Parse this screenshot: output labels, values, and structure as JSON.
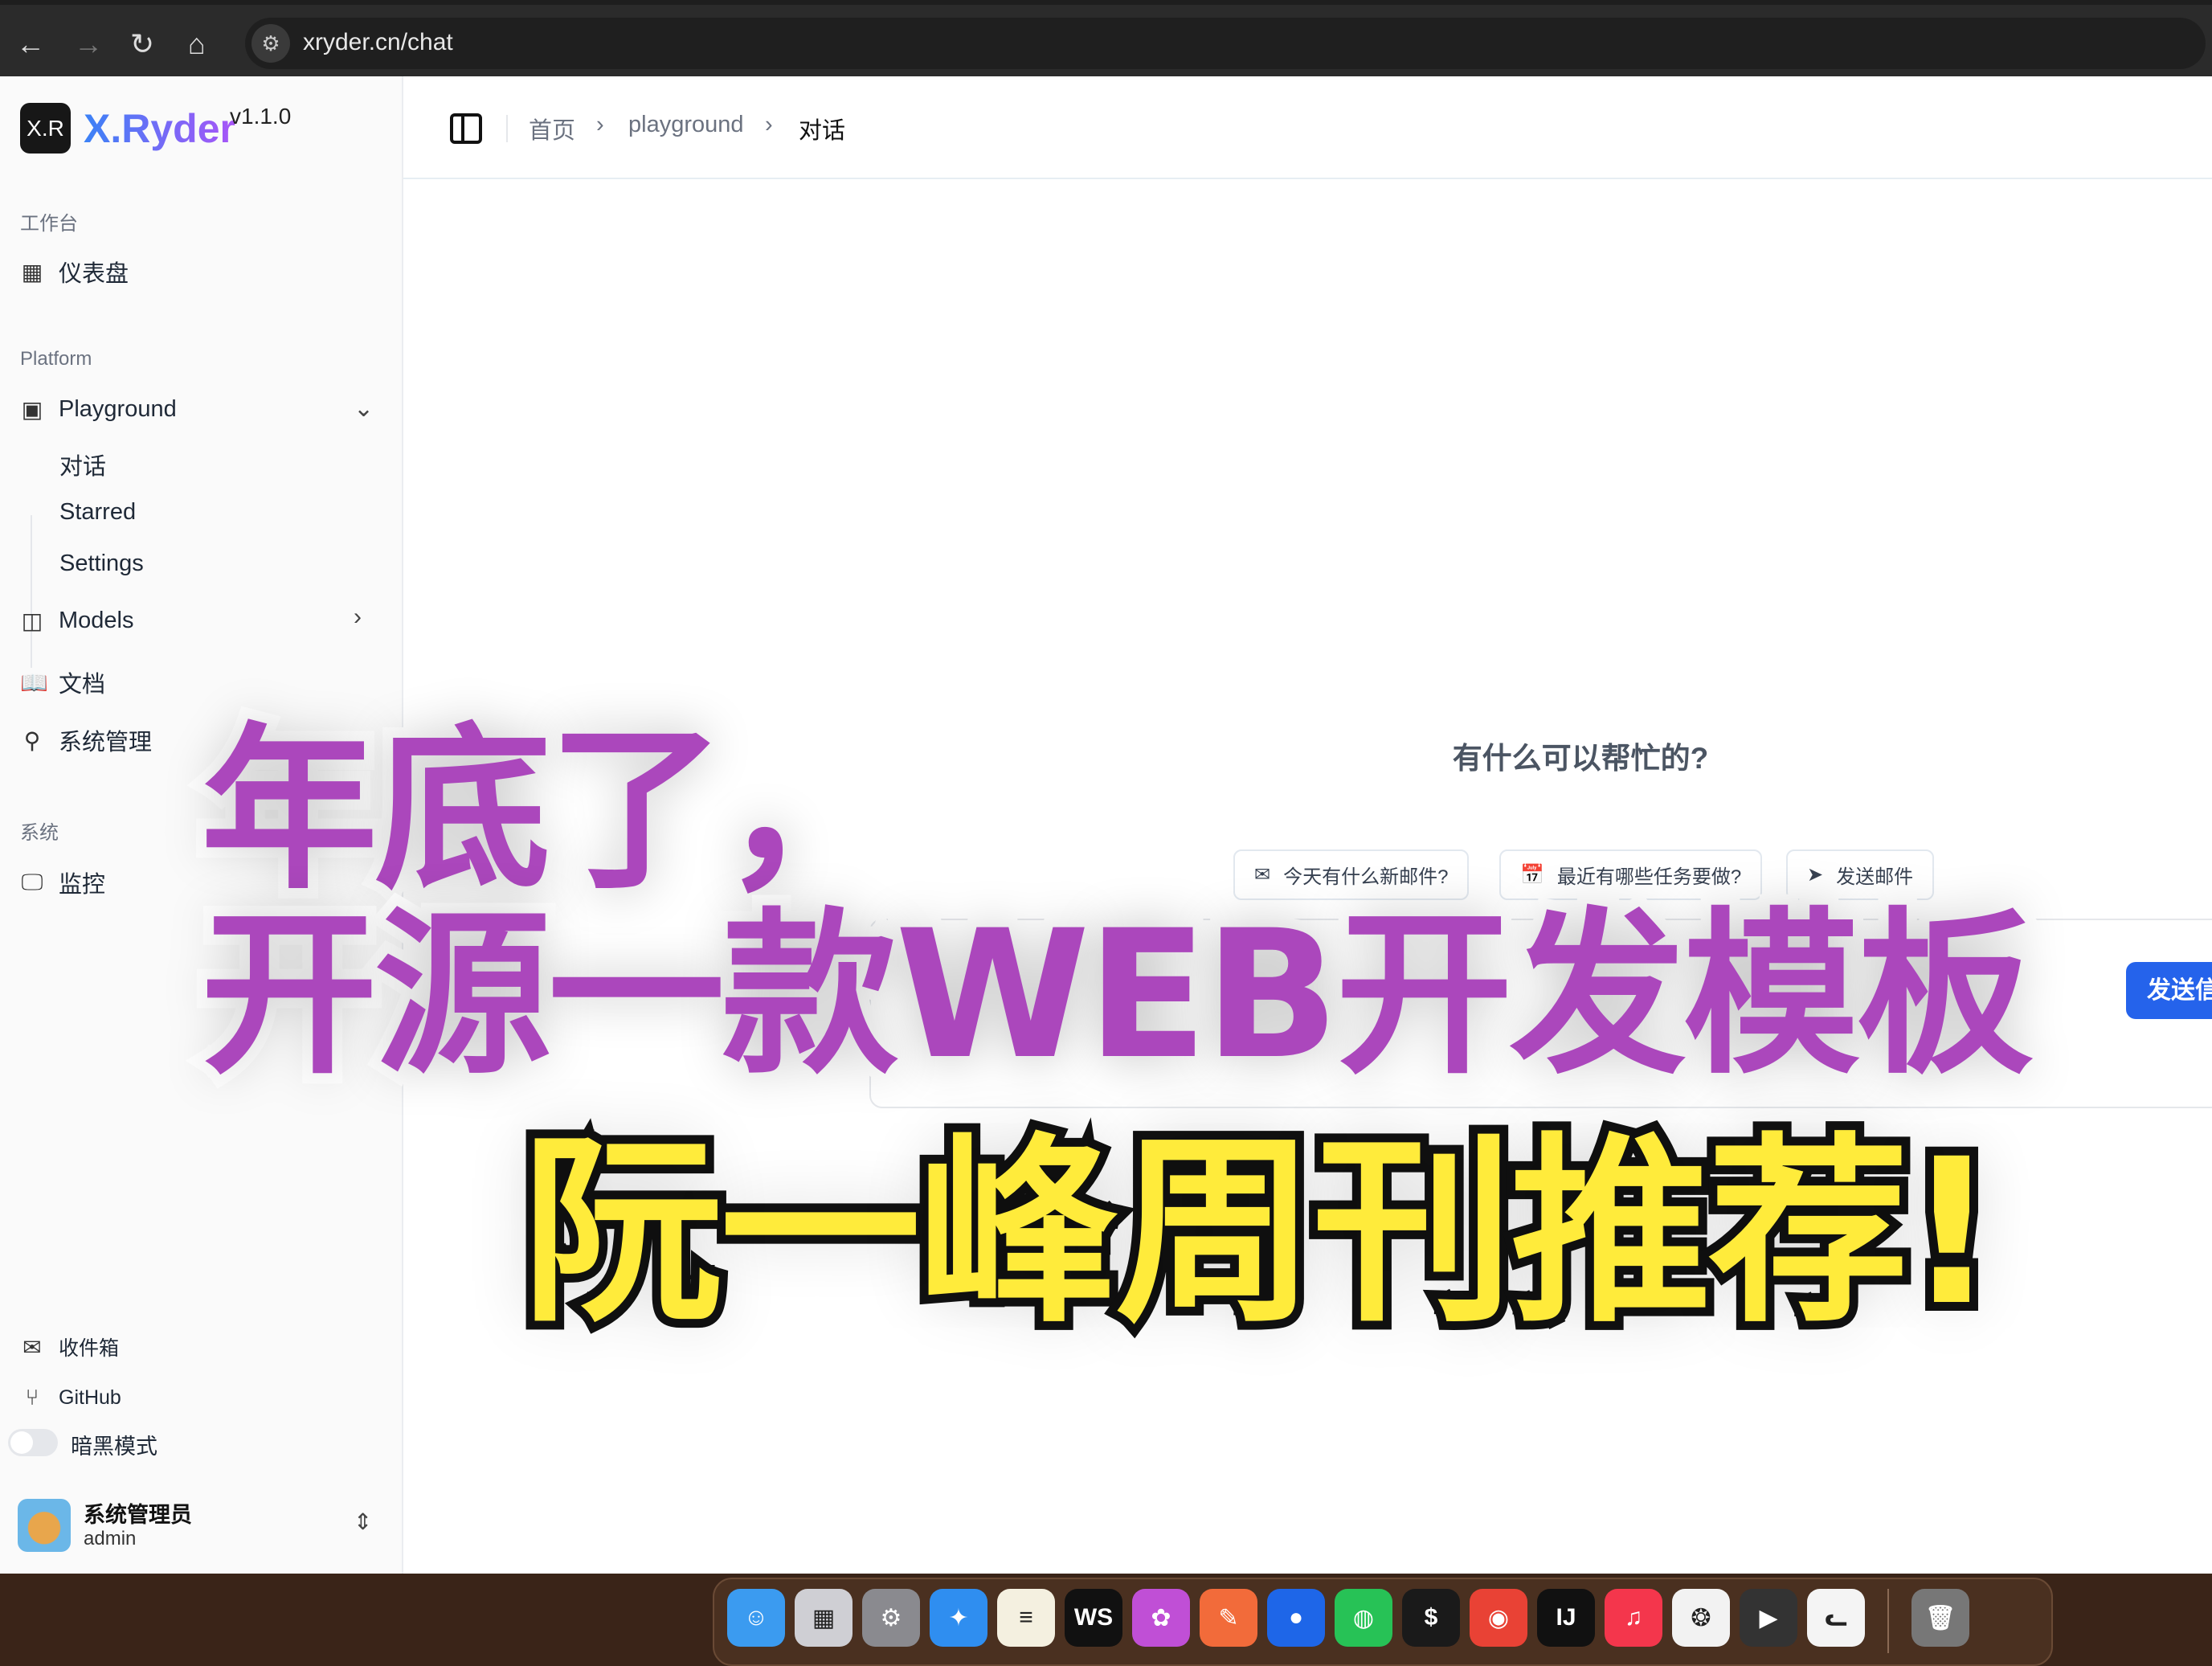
{
  "browser": {
    "url": "xryder.cn/chat",
    "back": "←",
    "forward": "→",
    "reload": "↻",
    "home": "⌂"
  },
  "sidebar": {
    "logo": "X.R",
    "brand": "X.Ryder",
    "version": "v1.1.0",
    "sections": {
      "workbench": "工作台",
      "platform": "Platform",
      "system": "系统"
    },
    "dashboard": "仪表盘",
    "playground": "Playground",
    "playground_items": [
      "对话",
      "Starred",
      "Settings"
    ],
    "models": "Models",
    "docs": "文档",
    "system_admin": "系统管理",
    "monitor": "监控",
    "inbox": "收件箱",
    "github": "GitHub",
    "dark_mode": "暗黑模式",
    "user": {
      "name": "系统管理员",
      "role": "admin"
    }
  },
  "breadcrumb": [
    "首页",
    "playground",
    "对话"
  ],
  "main": {
    "prompt": "有什么可以帮忙的?",
    "chips": [
      "今天有什么新邮件?",
      "最近有哪些任务要做?",
      "发送邮件"
    ],
    "send": "发送信"
  },
  "overlay": {
    "line1": "年底了，",
    "line2": "开源一款WEB开发模板",
    "line3": "阮一峰周刊推荐!"
  },
  "dock": [
    {
      "name": "Finder",
      "icon": "☺",
      "color": "#3b9bf0"
    },
    {
      "name": "Launchpad",
      "icon": "▦",
      "color": "#cfcfd4"
    },
    {
      "name": "System Settings",
      "icon": "⚙",
      "color": "#8a8a8f"
    },
    {
      "name": "Safari",
      "icon": "✦",
      "color": "#2f8ef0"
    },
    {
      "name": "Notes",
      "icon": "≡",
      "color": "#f4f0e0"
    },
    {
      "name": "WebStorm",
      "icon": "WS",
      "color": "#111"
    },
    {
      "name": "Flower",
      "icon": "✿",
      "color": "#c04fd6"
    },
    {
      "name": "Postman",
      "icon": "✎",
      "color": "#f26b3a"
    },
    {
      "name": "Pin",
      "icon": "●",
      "color": "#1e66e8"
    },
    {
      "name": "WeChat",
      "icon": "◍",
      "color": "#27c256"
    },
    {
      "name": "Terminal",
      "icon": "$",
      "color": "#1a1a1a"
    },
    {
      "name": "Chrome",
      "icon": "◉",
      "color": "#e94235"
    },
    {
      "name": "IntelliJ",
      "icon": "IJ",
      "color": "#111"
    },
    {
      "name": "Music",
      "icon": "♫",
      "color": "#f4364c"
    },
    {
      "name": "ChatGPT",
      "icon": "❂",
      "color": "#f2f2f2"
    },
    {
      "name": "Final Cut",
      "icon": "▶",
      "color": "#333"
    },
    {
      "name": "Cat",
      "icon": "ᓚ",
      "color": "#f4f4f4"
    },
    {
      "name": "Trash",
      "icon": "🗑",
      "color": "#777"
    }
  ]
}
